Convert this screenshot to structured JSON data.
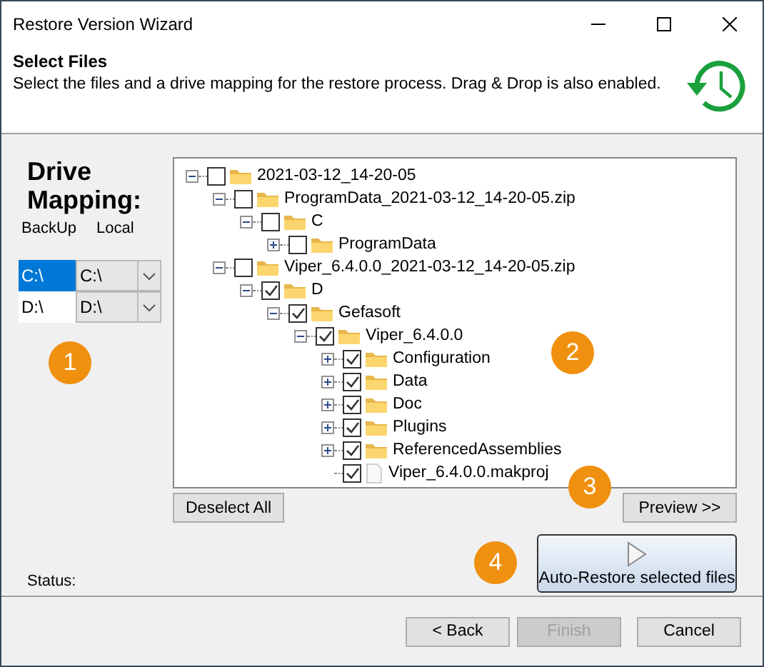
{
  "window": {
    "title": "Restore Version Wizard"
  },
  "header": {
    "title": "Select Files",
    "description": "Select the files and a drive mapping for the restore process. Drag & Drop is also enabled."
  },
  "drive_mapping": {
    "title": "Drive Mapping:",
    "columns": [
      "BackUp",
      "Local"
    ],
    "rows": [
      {
        "backup": "C:\\",
        "local": "C:\\",
        "selected": true
      },
      {
        "backup": "D:\\",
        "local": "D:\\",
        "selected": false
      }
    ]
  },
  "tree": [
    {
      "label": "2021-03-12_14-20-05",
      "kind": "folder",
      "checked": false,
      "expanded": true,
      "children": [
        {
          "label": "ProgramData_2021-03-12_14-20-05.zip",
          "kind": "folder",
          "checked": false,
          "expanded": true,
          "children": [
            {
              "label": "C",
              "kind": "folder",
              "checked": false,
              "expanded": true,
              "children": [
                {
                  "label": "ProgramData",
                  "kind": "folder",
                  "checked": false,
                  "expanded": false
                }
              ]
            }
          ]
        },
        {
          "label": "Viper_6.4.0.0_2021-03-12_14-20-05.zip",
          "kind": "folder",
          "checked": false,
          "expanded": true,
          "children": [
            {
              "label": "D",
              "kind": "folder",
              "checked": true,
              "expanded": true,
              "children": [
                {
                  "label": "Gefasoft",
                  "kind": "folder",
                  "checked": true,
                  "expanded": true,
                  "children": [
                    {
                      "label": "Viper_6.4.0.0",
                      "kind": "folder",
                      "checked": true,
                      "expanded": true,
                      "children": [
                        {
                          "label": "Configuration",
                          "kind": "folder",
                          "checked": true,
                          "expanded": false
                        },
                        {
                          "label": "Data",
                          "kind": "folder",
                          "checked": true,
                          "expanded": false
                        },
                        {
                          "label": "Doc",
                          "kind": "folder",
                          "checked": true,
                          "expanded": false
                        },
                        {
                          "label": "Plugins",
                          "kind": "folder",
                          "checked": true,
                          "expanded": false
                        },
                        {
                          "label": "ReferencedAssemblies",
                          "kind": "folder",
                          "checked": true,
                          "expanded": false
                        },
                        {
                          "label": "Viper_6.4.0.0.makproj",
                          "kind": "file",
                          "checked": true
                        }
                      ]
                    }
                  ]
                }
              ]
            }
          ]
        }
      ]
    }
  ],
  "deselect_button": "Deselect All",
  "preview_button": "Preview >>",
  "auto_restore_button": "Auto-Restore selected files",
  "status_label": "Status:",
  "badges": [
    "1",
    "2",
    "3",
    "4"
  ],
  "footer_buttons": [
    {
      "label": "< Back",
      "disabled": false
    },
    {
      "label": "Finish",
      "disabled": true
    },
    {
      "label": "Cancel",
      "disabled": false
    }
  ]
}
